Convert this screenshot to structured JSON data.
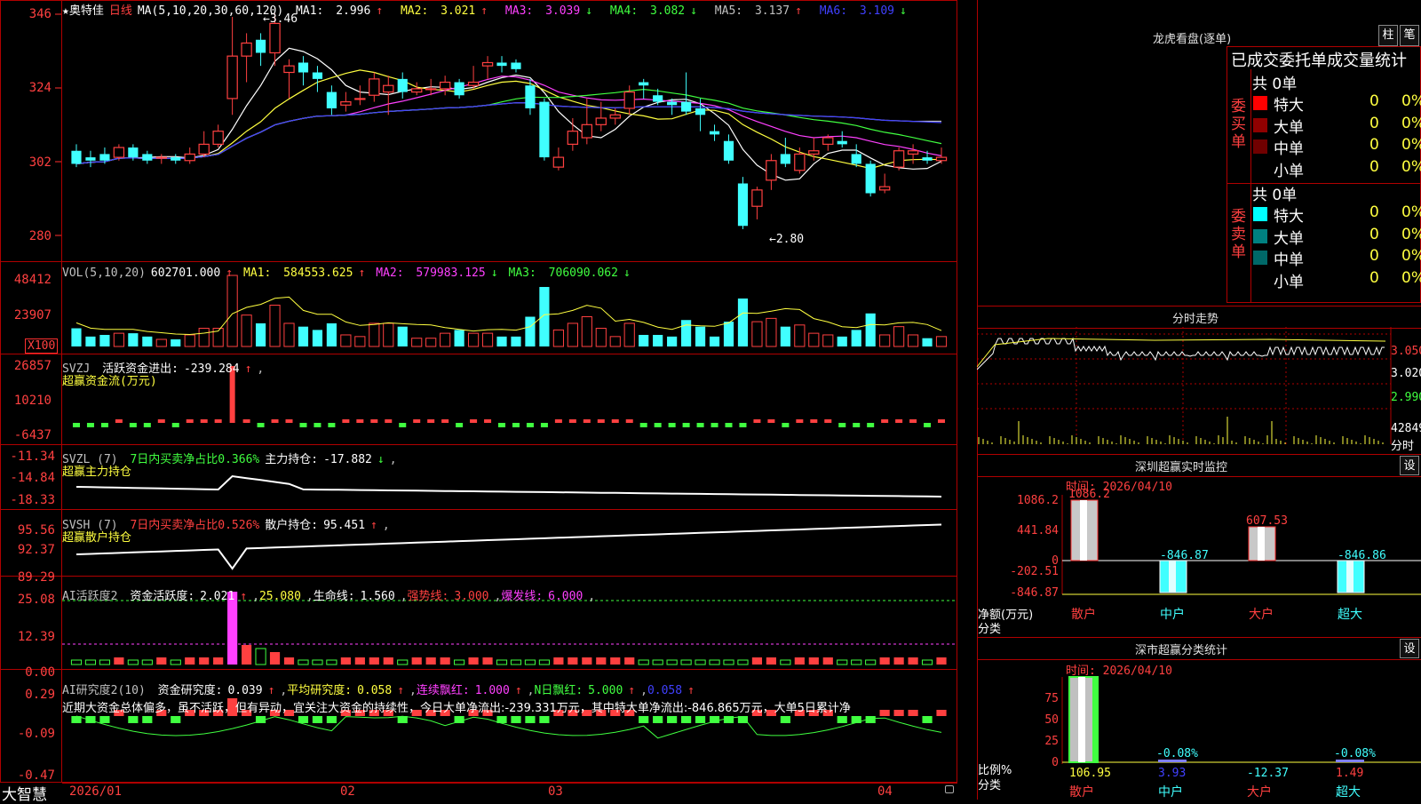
{
  "colors": {
    "up": "#ff4040",
    "down": "#40ffff",
    "frame": "#b00000",
    "axis": "#ff4040"
  },
  "price_panel": {
    "stock_name": "★奥特佳",
    "period": "日线",
    "ma_params": "MA(5,10,20,30,60,120)",
    "ma_values": [
      {
        "label": "MA1:",
        "value": "2.996",
        "arrow": "↑"
      },
      {
        "label": "MA2:",
        "value": "3.021",
        "arrow": "↑"
      },
      {
        "label": "MA3:",
        "value": "3.039",
        "arrow": "↓"
      },
      {
        "label": "MA4:",
        "value": "3.082",
        "arrow": "↓"
      },
      {
        "label": "MA5:",
        "value": "3.137",
        "arrow": "↑"
      },
      {
        "label": "MA6:",
        "value": "3.109",
        "arrow": "↓"
      }
    ],
    "y_labels": [
      "346",
      "324",
      "302",
      "280"
    ],
    "high_mark": "3.46",
    "low_mark": "2.80"
  },
  "chart_data": {
    "type": "candlestick",
    "y_unit": "price ×100 (axis)",
    "ylim": [
      2.74,
      3.48
    ],
    "candles": [
      {
        "o": 3.04,
        "c": 3.0,
        "h": 3.06,
        "l": 2.99
      },
      {
        "o": 3.02,
        "c": 3.01,
        "h": 3.04,
        "l": 2.99
      },
      {
        "o": 3.03,
        "c": 3.01,
        "h": 3.05,
        "l": 3.0
      },
      {
        "o": 3.02,
        "c": 3.05,
        "h": 3.06,
        "l": 3.01
      },
      {
        "o": 3.05,
        "c": 3.02,
        "h": 3.06,
        "l": 3.01
      },
      {
        "o": 3.03,
        "c": 3.01,
        "h": 3.04,
        "l": 3.0
      },
      {
        "o": 3.02,
        "c": 3.02,
        "h": 3.03,
        "l": 3.0
      },
      {
        "o": 3.02,
        "c": 3.01,
        "h": 3.03,
        "l": 3.0
      },
      {
        "o": 3.01,
        "c": 3.03,
        "h": 3.05,
        "l": 3.0
      },
      {
        "o": 3.03,
        "c": 3.06,
        "h": 3.1,
        "l": 3.02
      },
      {
        "o": 3.06,
        "c": 3.1,
        "h": 3.12,
        "l": 3.05
      },
      {
        "o": 3.2,
        "c": 3.33,
        "h": 3.45,
        "l": 3.15
      },
      {
        "o": 3.33,
        "c": 3.37,
        "h": 3.4,
        "l": 3.25
      },
      {
        "o": 3.38,
        "c": 3.34,
        "h": 3.4,
        "l": 3.3
      },
      {
        "o": 3.34,
        "c": 3.43,
        "h": 3.46,
        "l": 3.3
      },
      {
        "o": 3.28,
        "c": 3.3,
        "h": 3.32,
        "l": 3.2
      },
      {
        "o": 3.31,
        "c": 3.28,
        "h": 3.33,
        "l": 3.24
      },
      {
        "o": 3.28,
        "c": 3.26,
        "h": 3.3,
        "l": 3.22
      },
      {
        "o": 3.22,
        "c": 3.17,
        "h": 3.24,
        "l": 3.15
      },
      {
        "o": 3.18,
        "c": 3.19,
        "h": 3.22,
        "l": 3.16
      },
      {
        "o": 3.2,
        "c": 3.2,
        "h": 3.24,
        "l": 3.18
      },
      {
        "o": 3.21,
        "c": 3.26,
        "h": 3.28,
        "l": 3.19
      },
      {
        "o": 3.22,
        "c": 3.24,
        "h": 3.27,
        "l": 3.15
      },
      {
        "o": 3.26,
        "c": 3.22,
        "h": 3.28,
        "l": 3.2
      },
      {
        "o": 3.22,
        "c": 3.23,
        "h": 3.25,
        "l": 3.21
      },
      {
        "o": 3.23,
        "c": 3.23,
        "h": 3.26,
        "l": 3.21
      },
      {
        "o": 3.23,
        "c": 3.25,
        "h": 3.27,
        "l": 3.21
      },
      {
        "o": 3.25,
        "c": 3.21,
        "h": 3.26,
        "l": 3.2
      },
      {
        "o": 3.24,
        "c": 3.25,
        "h": 3.3,
        "l": 3.23
      },
      {
        "o": 3.3,
        "c": 3.31,
        "h": 3.33,
        "l": 3.26
      },
      {
        "o": 3.31,
        "c": 3.3,
        "h": 3.33,
        "l": 3.28
      },
      {
        "o": 3.31,
        "c": 3.29,
        "h": 3.32,
        "l": 3.28
      },
      {
        "o": 3.24,
        "c": 3.17,
        "h": 3.26,
        "l": 3.15
      },
      {
        "o": 3.19,
        "c": 3.02,
        "h": 3.2,
        "l": 3.01
      },
      {
        "o": 2.99,
        "c": 3.02,
        "h": 3.05,
        "l": 2.98
      },
      {
        "o": 3.06,
        "c": 3.1,
        "h": 3.14,
        "l": 3.04
      },
      {
        "o": 3.08,
        "c": 3.12,
        "h": 3.2,
        "l": 3.06
      },
      {
        "o": 3.12,
        "c": 3.14,
        "h": 3.19,
        "l": 3.1
      },
      {
        "o": 3.14,
        "c": 3.15,
        "h": 3.17,
        "l": 3.12
      },
      {
        "o": 3.17,
        "c": 3.22,
        "h": 3.24,
        "l": 3.15
      },
      {
        "o": 3.25,
        "c": 3.24,
        "h": 3.26,
        "l": 3.2
      },
      {
        "o": 3.21,
        "c": 3.19,
        "h": 3.23,
        "l": 3.18
      },
      {
        "o": 3.19,
        "c": 3.18,
        "h": 3.2,
        "l": 3.15
      },
      {
        "o": 3.19,
        "c": 3.16,
        "h": 3.28,
        "l": 3.15
      },
      {
        "o": 3.17,
        "c": 3.15,
        "h": 3.2,
        "l": 3.1
      },
      {
        "o": 3.1,
        "c": 3.09,
        "h": 3.12,
        "l": 3.07
      },
      {
        "o": 3.07,
        "c": 3.01,
        "h": 3.09,
        "l": 3.0
      },
      {
        "o": 2.94,
        "c": 2.81,
        "h": 2.96,
        "l": 2.8
      },
      {
        "o": 2.87,
        "c": 2.92,
        "h": 2.93,
        "l": 2.83
      },
      {
        "o": 2.95,
        "c": 3.01,
        "h": 3.03,
        "l": 2.92
      },
      {
        "o": 3.03,
        "c": 3.0,
        "h": 3.08,
        "l": 2.99
      },
      {
        "o": 2.98,
        "c": 3.03,
        "h": 3.05,
        "l": 2.97
      },
      {
        "o": 3.03,
        "c": 3.04,
        "h": 3.08,
        "l": 3.01
      },
      {
        "o": 3.06,
        "c": 3.08,
        "h": 3.09,
        "l": 3.04
      },
      {
        "o": 3.07,
        "c": 3.06,
        "h": 3.1,
        "l": 3.05
      },
      {
        "o": 3.03,
        "c": 3.0,
        "h": 3.06,
        "l": 2.99
      },
      {
        "o": 3.0,
        "c": 2.91,
        "h": 3.01,
        "l": 2.9
      },
      {
        "o": 2.92,
        "c": 2.93,
        "h": 2.97,
        "l": 2.91
      },
      {
        "o": 2.99,
        "c": 3.04,
        "h": 3.05,
        "l": 2.98
      },
      {
        "o": 3.03,
        "c": 3.04,
        "h": 3.06,
        "l": 3.0
      },
      {
        "o": 3.02,
        "c": 3.01,
        "h": 3.04,
        "l": 3.0
      },
      {
        "o": 3.01,
        "c": 3.02,
        "h": 3.05,
        "l": 3.0
      }
    ],
    "ma_lines": [
      {
        "name": "MA1",
        "color": "#ffffff"
      },
      {
        "name": "MA2",
        "color": "#ffff40"
      },
      {
        "name": "MA3",
        "color": "#ff40ff"
      },
      {
        "name": "MA4",
        "color": "#40ff40"
      },
      {
        "name": "MA5",
        "color": "#c0c0c0"
      },
      {
        "name": "MA6",
        "color": "#4040ff"
      }
    ]
  },
  "vol_panel": {
    "params": "VOL(5,10,20)",
    "vol_value": "602701.000",
    "ma_values": [
      {
        "label": "MA1:",
        "value": "584553.625",
        "arrow": "↑"
      },
      {
        "label": "MA2:",
        "value": "579983.125",
        "arrow": "↓"
      },
      {
        "label": "MA3:",
        "value": "706090.062",
        "arrow": "↓"
      }
    ],
    "y_labels": [
      "48412",
      "23907"
    ],
    "unit": "X100"
  },
  "svzj_panel": {
    "label": "SVZJ",
    "desc": "活跃资金进出:",
    "value": "-239.284",
    "arrow": "↑",
    "subtitle": "超赢资金流(万元)",
    "y_labels": [
      "26857",
      "10210",
      "-6437"
    ]
  },
  "svzl_panel": {
    "label": "SVZL (7)",
    "desc1": "7日内买卖净占比0.366%",
    "desc2": "主力持仓:",
    "value": "-17.882",
    "arrow": "↓",
    "subtitle": "超赢主力持仓",
    "y_labels": [
      "-11.34",
      "-14.84",
      "-18.33"
    ]
  },
  "svsh_panel": {
    "label": "SVSH (7)",
    "desc1": "7日内买卖净占比0.526%",
    "desc2": "散户持仓:",
    "value": "95.451",
    "arrow": "↑",
    "subtitle": "超赢散户持仓",
    "y_labels": [
      "95.56",
      "92.37",
      "89.29"
    ]
  },
  "ai_active_panel": {
    "label": "AI活跃度2",
    "desc": "资金活跃度:",
    "value": "2.021",
    "arrow": "↑",
    "v2": "25.080",
    "life_label": "生命线:",
    "life_value": "1.560",
    "strong_label": "强势线:",
    "strong_value": "3.000",
    "burst_label": "爆发线:",
    "burst_value": "6.000",
    "y_labels": [
      "25.08",
      "12.39",
      "0.00"
    ]
  },
  "ai_research_panel": {
    "label": "AI研究度2(10)",
    "items": [
      {
        "label": "资金研究度:",
        "value": "0.039",
        "arrow": "↑"
      },
      {
        "label": "平均研究度:",
        "value": "0.058",
        "arrow": "↑"
      },
      {
        "label": "连续飘红:",
        "value": "1.000",
        "arrow": "↑"
      },
      {
        "label": "N日飘红:",
        "value": "5.000",
        "arrow": "↑"
      },
      {
        "label": "",
        "value": "0.058",
        "arrow": "↑"
      }
    ],
    "comment": "近期大资金总体偏多，虽不活跃，但有异动，宜关注大资金的持续性，今日大单净流出:-239.331万元，其中特大单净流出:-846.865万元，大单5日累计净",
    "y_labels": [
      "0.29",
      "-0.09",
      "-0.47"
    ]
  },
  "bottom_axis": {
    "app_name": "大智慧",
    "dates": [
      "2026/01",
      "02",
      "03",
      "04"
    ]
  },
  "right_panel": {
    "dragon_title": "龙虎看盘(逐单)",
    "btn_bar": "柱",
    "btn_pen": "笔",
    "stats_title": "已成交委托单成交量统计",
    "buy_side": {
      "label": "委买单",
      "total": "共 0单",
      "rows": [
        {
          "name": "特大",
          "value": "0",
          "pct": "0%",
          "color": "#ff0000"
        },
        {
          "name": "大单",
          "value": "0",
          "pct": "0%",
          "color": "#900000"
        },
        {
          "name": "中单",
          "value": "0",
          "pct": "0%",
          "color": "#700000"
        },
        {
          "name": "小单",
          "value": "0",
          "pct": "0%",
          "color": "#000000"
        }
      ]
    },
    "sell_side": {
      "label": "委卖单",
      "total": "共 0单",
      "rows": [
        {
          "name": "特大",
          "value": "0",
          "pct": "0%",
          "color": "#00ffff"
        },
        {
          "name": "大单",
          "value": "0",
          "pct": "0%",
          "color": "#008080"
        },
        {
          "name": "中单",
          "value": "0",
          "pct": "0%",
          "color": "#006868"
        },
        {
          "name": "小单",
          "value": "0",
          "pct": "0%",
          "color": "#000000"
        }
      ]
    },
    "intraday_title": "分时走势",
    "intraday_labels": [
      "3.050",
      "3.020",
      "2.990",
      "42849",
      "分时"
    ],
    "sz_monitor": {
      "title": "深圳超赢实时监控",
      "settings": "设",
      "time": "时间: 2026/04/10",
      "y_labels": [
        "1086.2",
        "441.84",
        "0",
        "-202.51",
        "-846.87"
      ],
      "y_unit": "净额(万元)",
      "x_unit": "分类",
      "bars": [
        {
          "cat": "散户",
          "value": 1086.2,
          "label": "1086.2"
        },
        {
          "cat": "中户",
          "value": -846.87,
          "label": "-846.87"
        },
        {
          "cat": "大户",
          "value": 607.53,
          "label": "607.53"
        },
        {
          "cat": "超大",
          "value": -846.86,
          "label": "-846.86"
        }
      ]
    },
    "sc_stats": {
      "title": "深市超赢分类统计",
      "settings": "设",
      "time": "时间: 2026/04/10",
      "y_labels": [
        "75",
        "50",
        "25",
        "0"
      ],
      "y_unit": "比例%",
      "x_unit": "分类",
      "bars": [
        {
          "cat": "散户",
          "value": 106.95,
          "label": "106.95",
          "top_label": ""
        },
        {
          "cat": "中户",
          "value": 3.93,
          "label": "3.93",
          "top_label": "-0.08%"
        },
        {
          "cat": "大户",
          "value": -12.37,
          "label": "-12.37",
          "top_label": ""
        },
        {
          "cat": "超大",
          "value": 1.49,
          "label": "1.49",
          "top_label": "-0.08%"
        }
      ]
    }
  }
}
